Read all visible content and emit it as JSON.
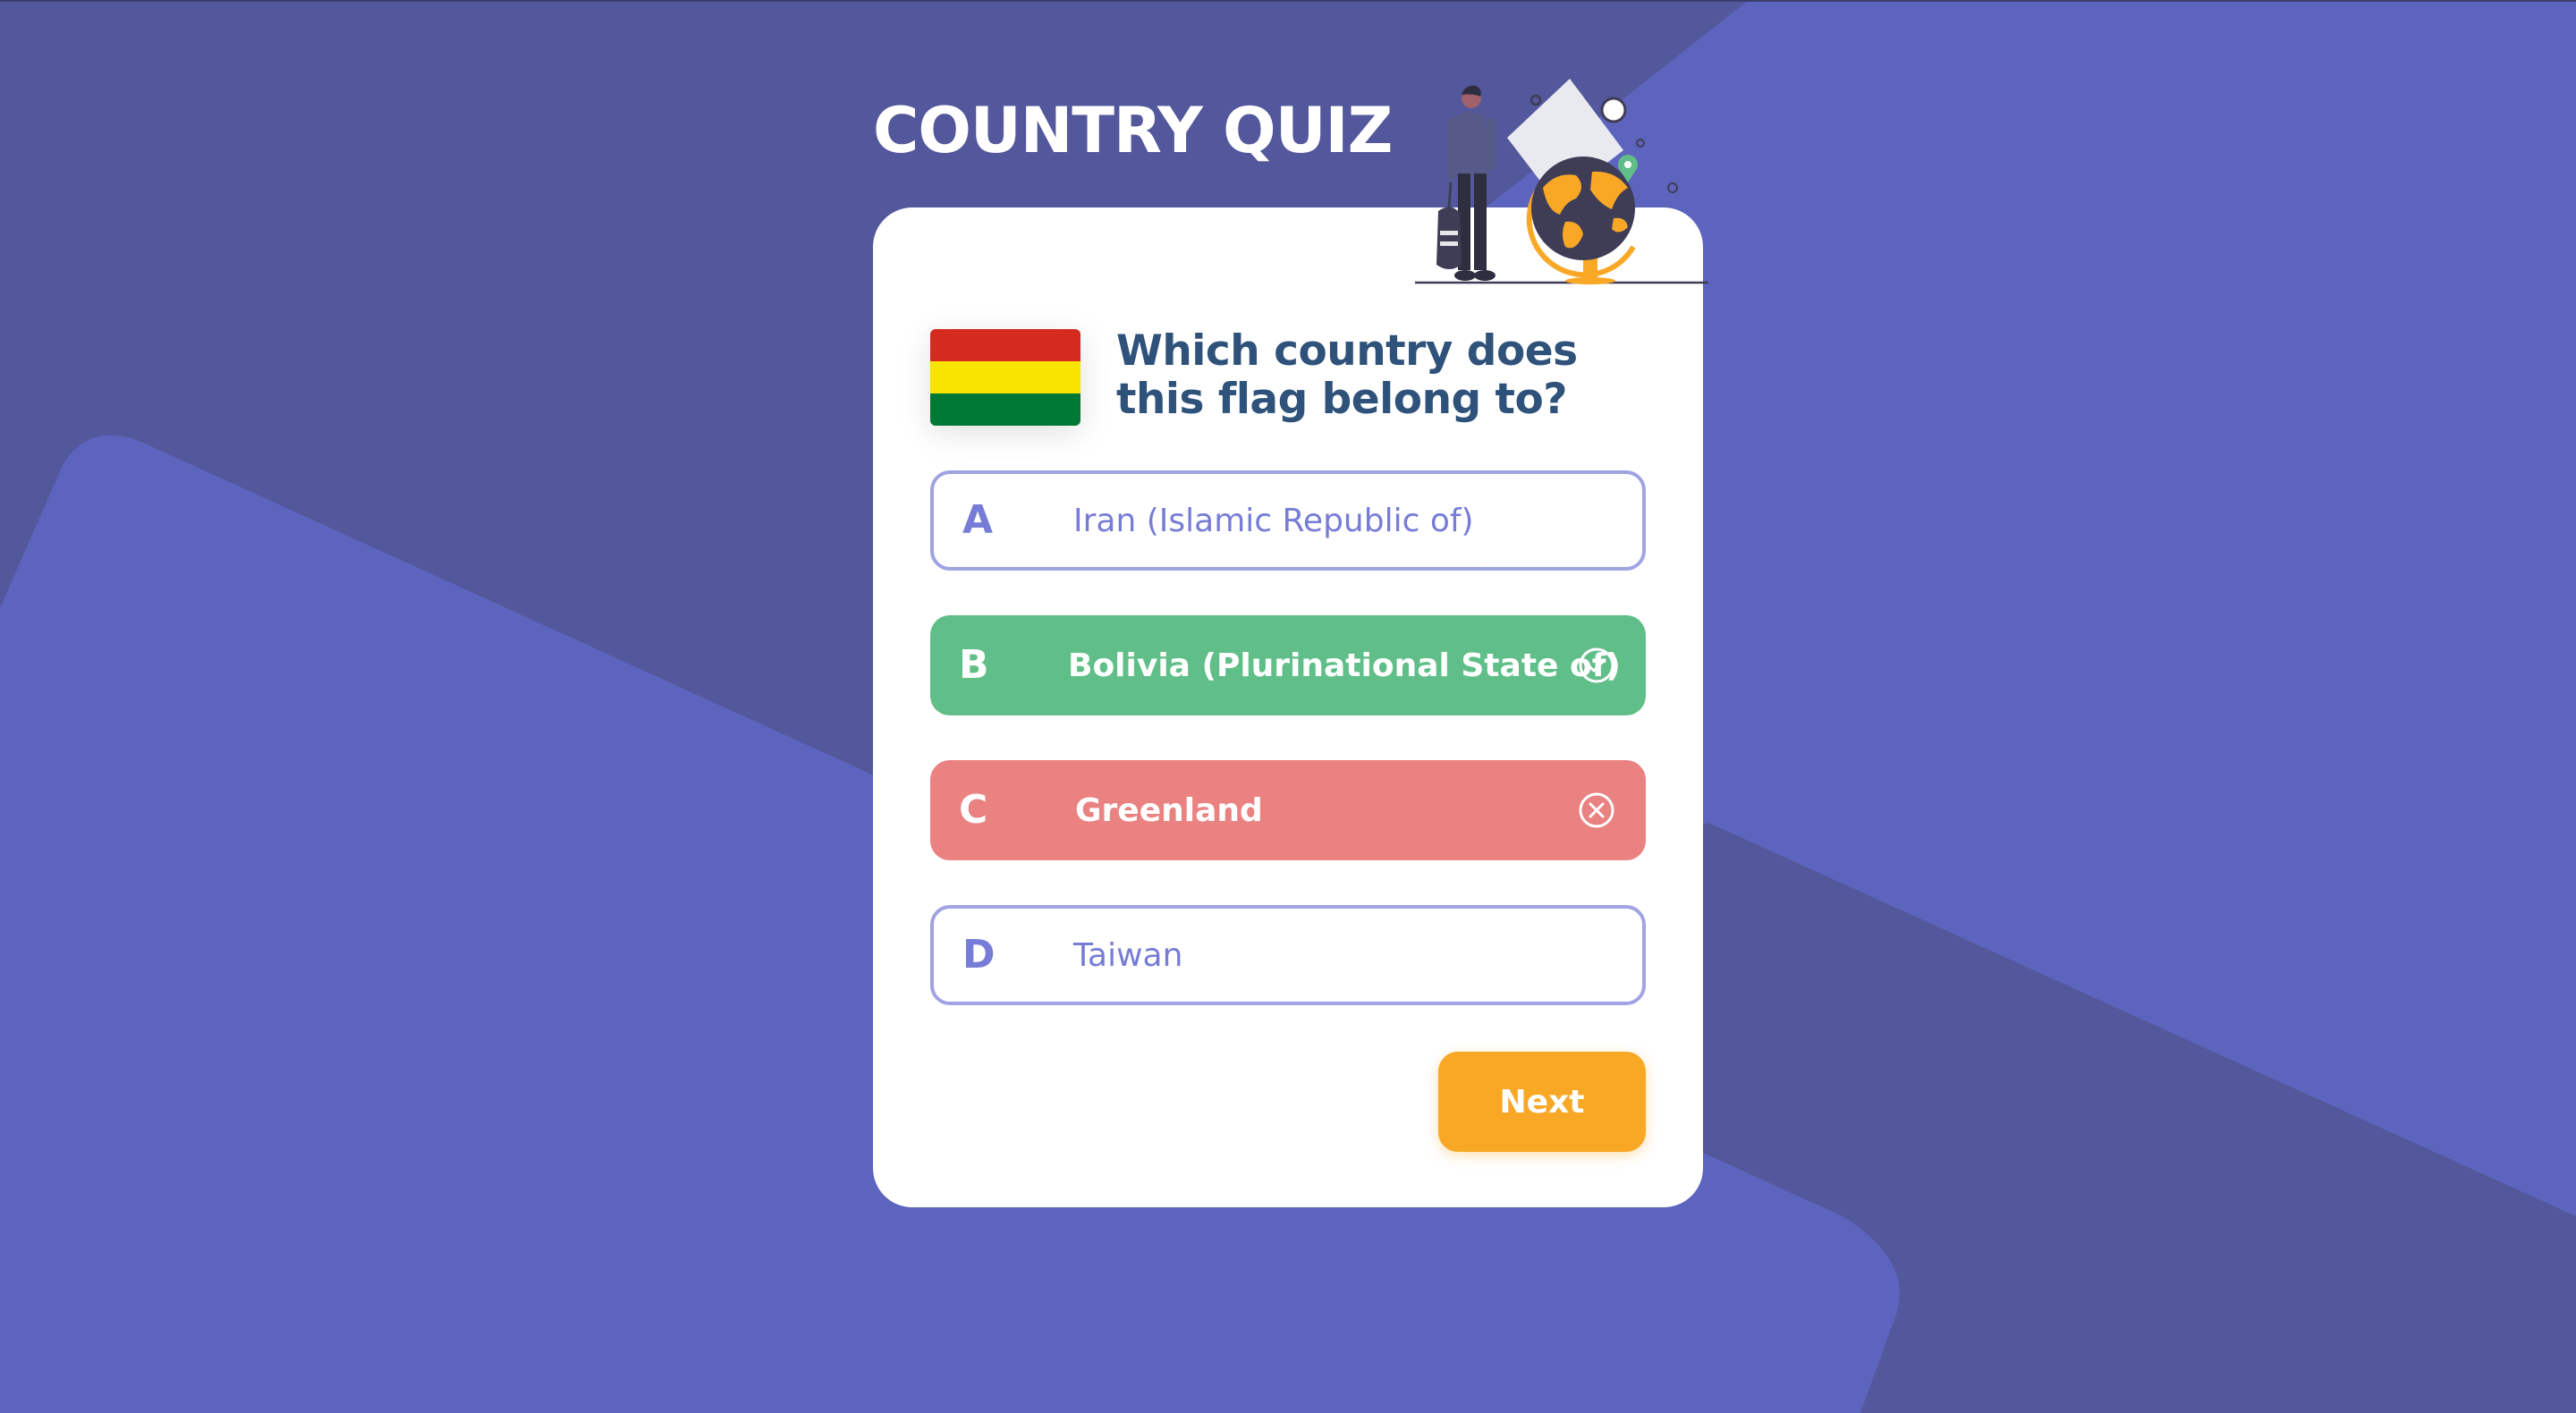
{
  "app": {
    "title": "COUNTRY QUIZ"
  },
  "question": {
    "text": "Which country does this flag belong to?",
    "flag_colors": [
      "#d52b1e",
      "#f9e300",
      "#007934"
    ]
  },
  "options": [
    {
      "letter": "A",
      "text": "Iran (Islamic Republic of)",
      "state": "default"
    },
    {
      "letter": "B",
      "text": "Bolivia (Plurinational State of)",
      "state": "correct",
      "icon": "check-circle-icon"
    },
    {
      "letter": "C",
      "text": "Greenland",
      "state": "wrong",
      "icon": "x-circle-icon"
    },
    {
      "letter": "D",
      "text": "Taiwan",
      "state": "default"
    }
  ],
  "next_button": {
    "label": "Next"
  },
  "colors": {
    "background": "#5a5d9f",
    "card": "#ffffff",
    "question_text": "#2f527b",
    "option_outline": "#6066d0",
    "correct": "#60bf88",
    "wrong": "#ea8282",
    "next_button": "#f9a826"
  }
}
